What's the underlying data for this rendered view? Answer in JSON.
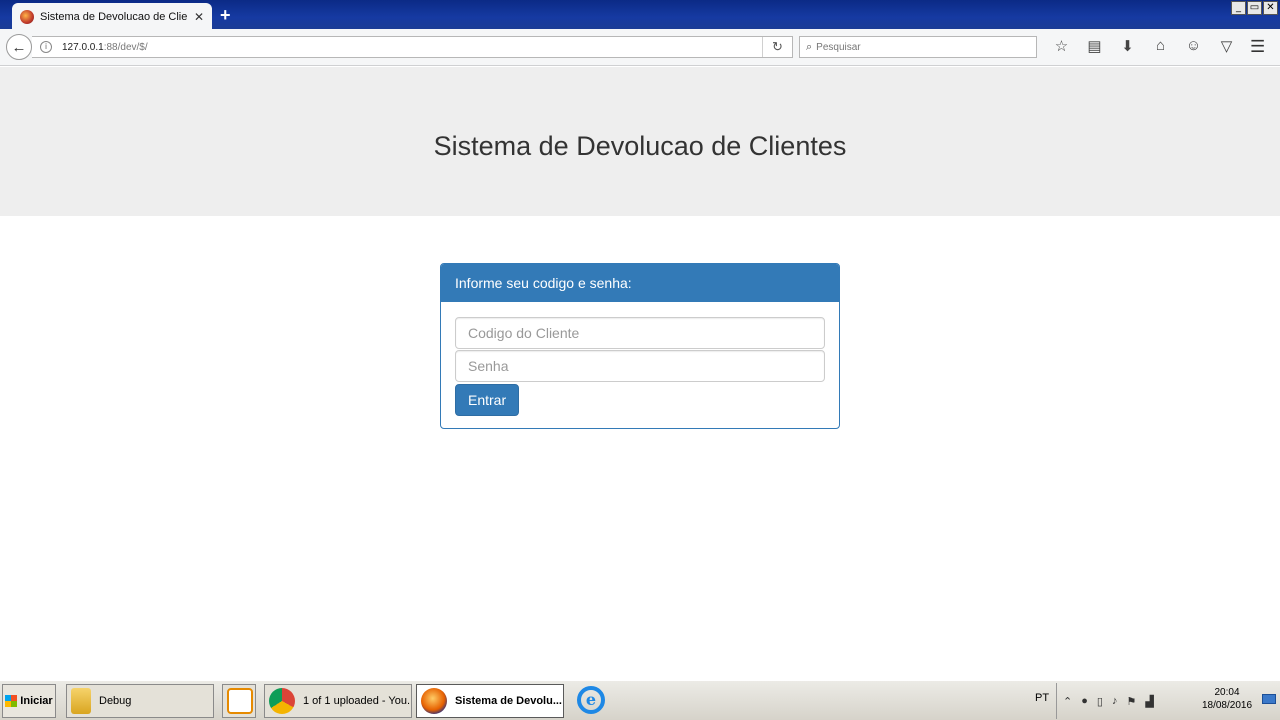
{
  "browser": {
    "tab_title": "Sistema de Devolucao de Clie...",
    "tab_close": "✕",
    "new_tab": "+",
    "url_host": "127.0.0.1",
    "url_path": ":88/dev/$/",
    "search_placeholder": "Pesquisar",
    "window_controls": [
      "_",
      "▭",
      "✕"
    ]
  },
  "page": {
    "title": "Sistema de Devolucao de Clientes",
    "panel_heading": "Informe seu codigo e senha:",
    "codigo_placeholder": "Codigo do Cliente",
    "senha_placeholder": "Senha",
    "submit_label": "Entrar",
    "accent_color": "#337ab7"
  },
  "taskbar": {
    "start_label": "Iniciar",
    "tasks": [
      {
        "label": "Debug",
        "icon": "folder-icon"
      },
      {
        "label": "",
        "icon": "media-player-icon"
      },
      {
        "label": "1 of 1 uploaded - You...",
        "icon": "chrome-icon"
      },
      {
        "label": "Sistema de Devolu...",
        "icon": "firefox-icon"
      }
    ],
    "language": "PT",
    "time": "20:04",
    "date": "18/08/2016"
  }
}
